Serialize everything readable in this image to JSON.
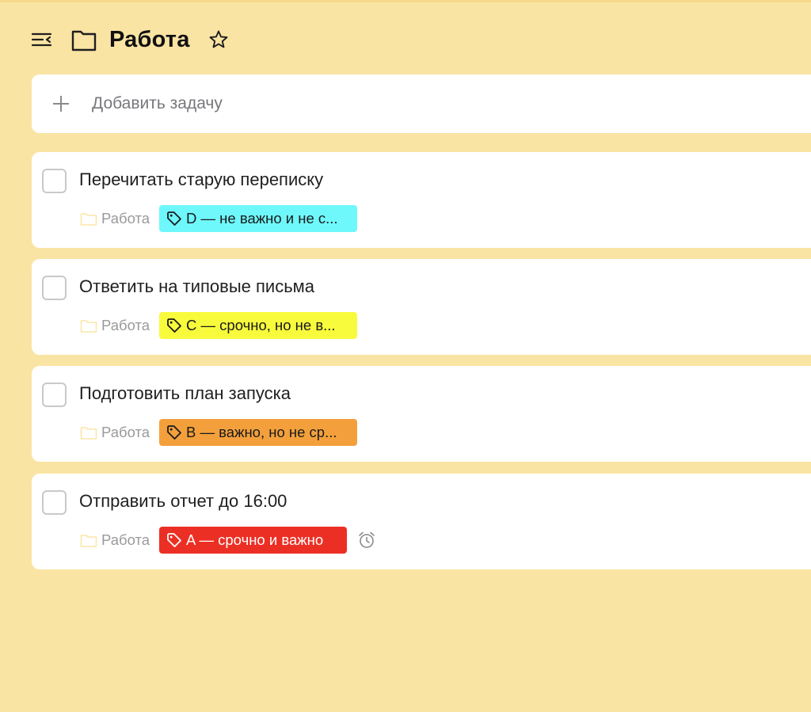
{
  "header": {
    "title": "Работа"
  },
  "add_task": {
    "label": "Добавить задачу"
  },
  "tasks": [
    {
      "title": "Перечитать старую переписку",
      "project": "Работа",
      "tag": {
        "label": "D — не важно и не с...",
        "bg": "#6ef8fb",
        "fg": "#1a1a1a"
      },
      "has_reminder": false
    },
    {
      "title": "Ответить на типовые письма",
      "project": "Работа",
      "tag": {
        "label": "C — срочно, но не в...",
        "bg": "#f8fb3c",
        "fg": "#1a1a1a"
      },
      "has_reminder": false
    },
    {
      "title": "Подготовить план запуска",
      "project": "Работа",
      "tag": {
        "label": "B — важно, но не ср...",
        "bg": "#f3a03c",
        "fg": "#1a1a1a"
      },
      "has_reminder": false
    },
    {
      "title": "Отправить отчет до 16:00",
      "project": "Работа",
      "tag": {
        "label": "A — срочно и важно",
        "bg": "#ec2f24",
        "fg": "#ffffff"
      },
      "has_reminder": true
    }
  ],
  "colors": {
    "background": "#fae4a3",
    "card": "#ffffff",
    "project_folder_icon": "#fbe6a8"
  },
  "icons": {
    "menu": "collapse-menu-icon",
    "project": "folder-icon",
    "favorite": "star-outline-icon",
    "add": "plus-icon",
    "tag": "tag-icon",
    "reminder": "alarm-clock-icon"
  }
}
